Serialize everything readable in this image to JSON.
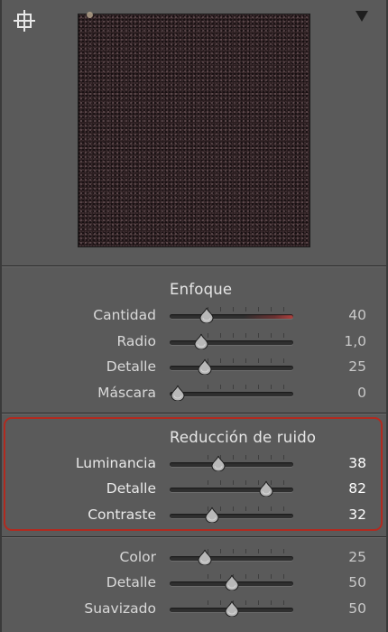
{
  "panel": {
    "enfoque": {
      "title": "Enfoque",
      "rows": [
        {
          "label": "Cantidad",
          "value": "40",
          "fraction": 0.27
        },
        {
          "label": "Radio",
          "value": "1,0",
          "fraction": 0.22
        },
        {
          "label": "Detalle",
          "value": "25",
          "fraction": 0.25
        },
        {
          "label": "Máscara",
          "value": "0",
          "fraction": 0.0
        }
      ]
    },
    "reduccion": {
      "title": "Reducción de ruido",
      "rows": [
        {
          "label": "Luminancia",
          "value": "38",
          "fraction": 0.38
        },
        {
          "label": "Detalle",
          "value": "82",
          "fraction": 0.82
        },
        {
          "label": "Contraste",
          "value": "32",
          "fraction": 0.32
        }
      ]
    },
    "color": {
      "rows": [
        {
          "label": "Color",
          "value": "25",
          "fraction": 0.25
        },
        {
          "label": "Detalle",
          "value": "50",
          "fraction": 0.5
        },
        {
          "label": "Suavizado",
          "value": "50",
          "fraction": 0.5
        }
      ]
    }
  },
  "icons": {
    "target": "target-adjustment-icon",
    "collapse": "triangle-down-icon"
  },
  "colors": {
    "highlight_box": "#b22a1f",
    "cantidad_track": "#b0413e"
  }
}
